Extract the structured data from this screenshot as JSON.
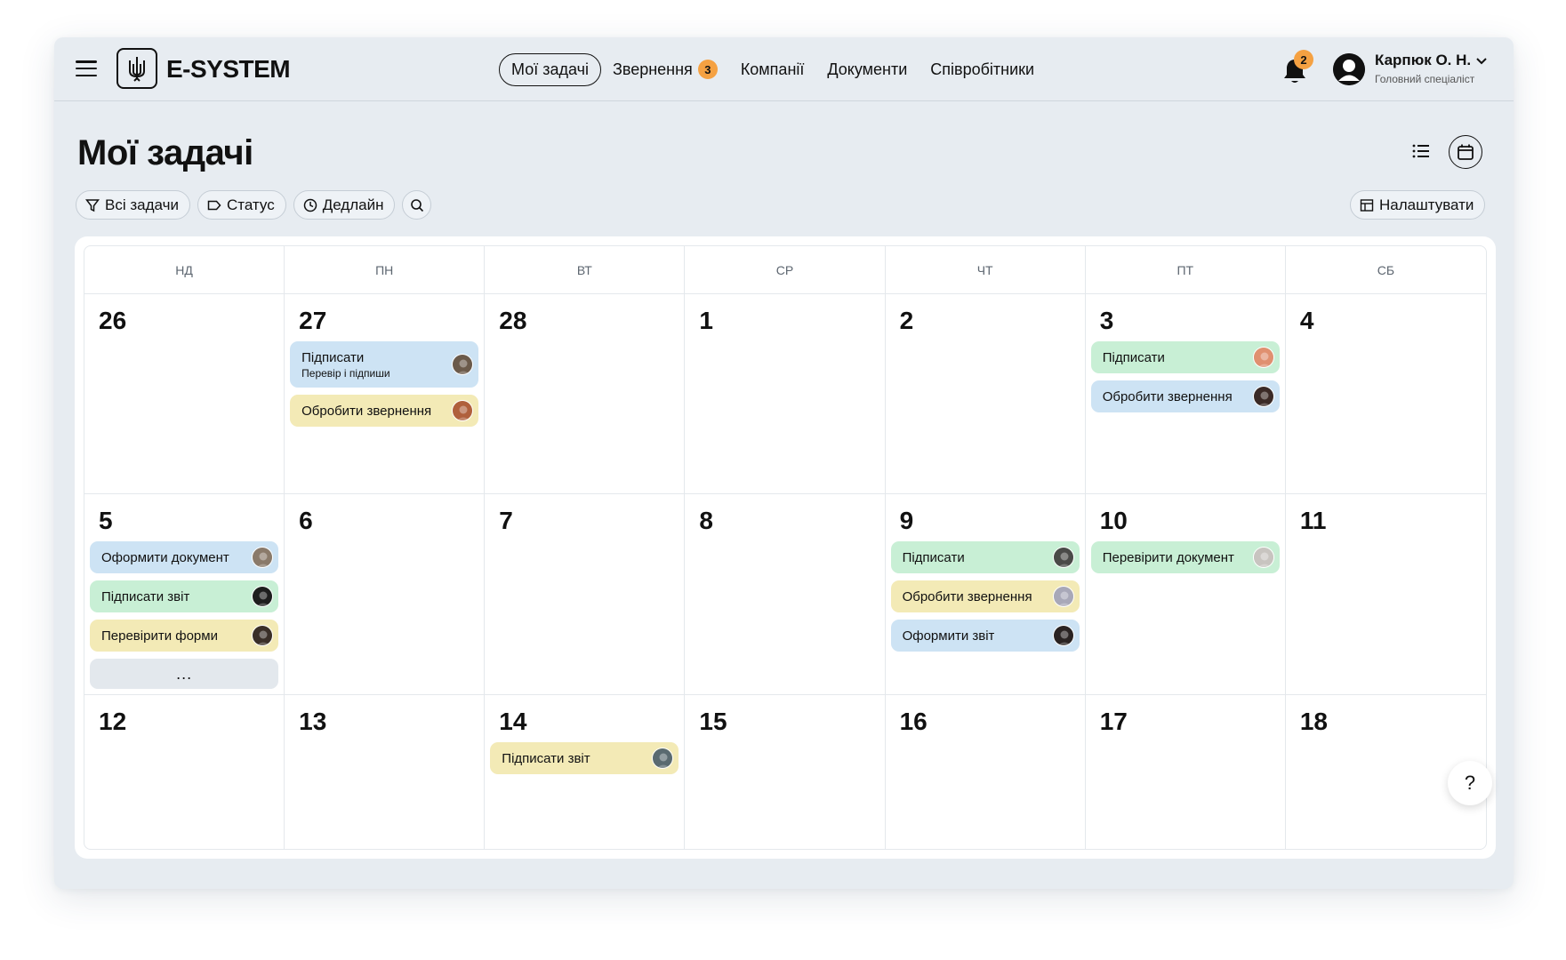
{
  "app": {
    "logo_text": "E-SYSTEM"
  },
  "nav": {
    "items": [
      {
        "label": "Мої задачі",
        "active": true
      },
      {
        "label": "Звернення",
        "badge": "3"
      },
      {
        "label": "Компанії"
      },
      {
        "label": "Документи"
      },
      {
        "label": "Співробітники"
      }
    ]
  },
  "notifications": {
    "count": "2"
  },
  "user": {
    "name": "Карпюк О. Н.",
    "role": "Головний спеціаліст"
  },
  "page": {
    "title": "Мої задачі"
  },
  "filters": {
    "all_tasks": "Всі задачи",
    "status": "Статус",
    "deadline": "Дедлайн",
    "settings": "Налаштувати"
  },
  "calendar": {
    "weekdays": [
      "НД",
      "ПН",
      "ВТ",
      "СР",
      "ЧТ",
      "ПТ",
      "СБ"
    ],
    "days": [
      {
        "num": "26",
        "tasks": []
      },
      {
        "num": "27",
        "tasks": [
          {
            "label": "Підписати",
            "sub": "Перевір і підпиши",
            "color": "blue",
            "avatar": "#6b5a4a"
          },
          {
            "label": "Обробити звернення",
            "color": "yellow",
            "avatar": "#b0603c"
          }
        ]
      },
      {
        "num": "28",
        "tasks": []
      },
      {
        "num": "1",
        "tasks": []
      },
      {
        "num": "2",
        "tasks": []
      },
      {
        "num": "3",
        "tasks": [
          {
            "label": "Підписати",
            "color": "green",
            "avatar": "#e09070"
          },
          {
            "label": "Обробити звернення",
            "color": "blue",
            "avatar": "#3a2a26"
          }
        ]
      },
      {
        "num": "4",
        "tasks": []
      },
      {
        "num": "5",
        "tasks": [
          {
            "label": "Оформити документ",
            "color": "blue",
            "avatar": "#8a7a6a"
          },
          {
            "label": "Підписати звіт",
            "color": "green",
            "avatar": "#1e1e1e"
          },
          {
            "label": "Перевірити форми",
            "color": "yellow",
            "avatar": "#3a2f28"
          }
        ],
        "more": "..."
      },
      {
        "num": "6",
        "tasks": []
      },
      {
        "num": "7",
        "tasks": []
      },
      {
        "num": "8",
        "tasks": []
      },
      {
        "num": "9",
        "tasks": [
          {
            "label": "Підписати",
            "color": "green",
            "avatar": "#4a4a48"
          },
          {
            "label": "Обробити звернення",
            "color": "yellow",
            "avatar": "#a8a8b8"
          },
          {
            "label": "Оформити звіт",
            "color": "blue",
            "avatar": "#2a2322"
          }
        ]
      },
      {
        "num": "10",
        "tasks": [
          {
            "label": "Перевірити документ",
            "color": "green",
            "avatar": "#c8c4c0"
          }
        ]
      },
      {
        "num": "11",
        "tasks": []
      },
      {
        "num": "12",
        "tasks": []
      },
      {
        "num": "13",
        "tasks": []
      },
      {
        "num": "14",
        "tasks": [
          {
            "label": "Підписати звіт",
            "color": "yellow",
            "avatar": "#5a6a70"
          }
        ]
      },
      {
        "num": "15",
        "tasks": []
      },
      {
        "num": "16",
        "tasks": []
      },
      {
        "num": "17",
        "tasks": []
      },
      {
        "num": "18",
        "tasks": []
      }
    ]
  },
  "help": {
    "label": "?"
  },
  "colors": {
    "accent": "#f5a142",
    "blue": "#cde3f4",
    "green": "#c8efd5",
    "yellow": "#f3eab6",
    "window_bg": "#e7ecf1"
  }
}
